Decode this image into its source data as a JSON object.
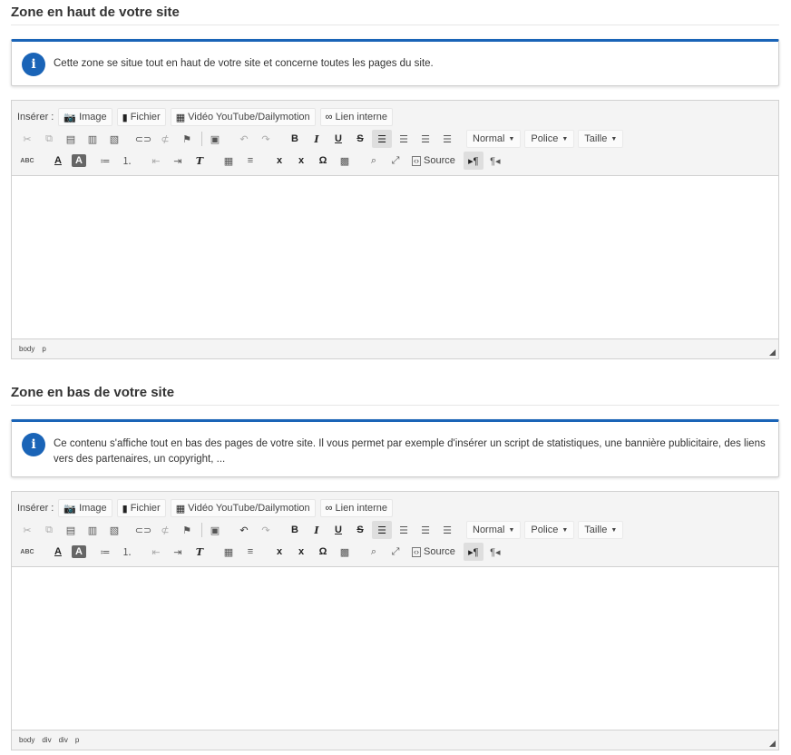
{
  "top_zone": {
    "title": "Zone en haut de votre site",
    "info": "Cette zone se situe tout en haut de votre site et concerne toutes les pages du site.",
    "path": [
      "body",
      "p"
    ]
  },
  "bottom_zone": {
    "title": "Zone en bas de votre site",
    "info": "Ce contenu s'affiche tout en bas des pages de votre site. Il vous permet par exemple d'insérer un script de statistiques, une bannière publicitaire, des liens vers des partenaires, un copyright, ...",
    "path": [
      "body",
      "div",
      "div",
      "p"
    ]
  },
  "toolbar": {
    "insert_label": "Insérer :",
    "image": "Image",
    "file": "Fichier",
    "video": "Vidéo YouTube/Dailymotion",
    "internal_link": "Lien interne",
    "format": "Normal",
    "font": "Police",
    "size": "Taille",
    "source": "Source",
    "bold": "B",
    "italic": "I",
    "underline": "U",
    "strike": "S",
    "omega": "Ω",
    "spell": "ABC",
    "text_color": "A",
    "bg_color": "A",
    "subscript": "x",
    "superscript": "x",
    "remove_format": "T",
    "ltr": "▸¶",
    "rtl": "¶◂"
  },
  "colors": {
    "accent": "#1a64b7"
  }
}
